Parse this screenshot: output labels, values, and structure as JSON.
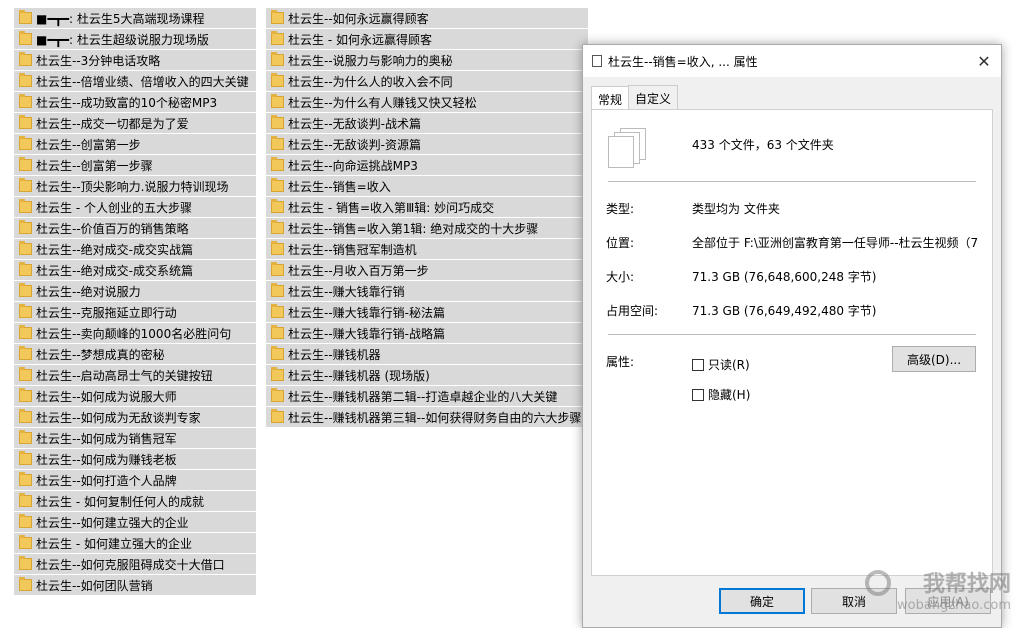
{
  "left_list": [
    "■━┳━: 杜云生5大高端现场课程",
    "■━┳━: 杜云生超级说服力现场版",
    "杜云生--3分钟电话攻略",
    "杜云生--倍增业绩、倍增收入的四大关键",
    "杜云生--成功致富的10个秘密MP3",
    "杜云生--成交一切都是为了爱",
    "杜云生--创富第一步",
    "杜云生--创富第一步骤",
    "杜云生--顶尖影响力.说服力特训现场",
    "杜云生 - 个人创业的五大步骤",
    "杜云生--价值百万的销售策略",
    "杜云生--绝对成交-成交实战篇",
    "杜云生--绝对成交-成交系统篇",
    "杜云生--绝对说服力",
    "杜云生--克服拖延立即行动",
    "杜云生--卖向颠峰的1000名必胜问句",
    "杜云生--梦想成真的密秘",
    "杜云生--启动高昂士气的关键按钮",
    "杜云生--如何成为说服大师",
    "杜云生--如何成为无敌谈判专家",
    "杜云生--如何成为销售冠军",
    "杜云生--如何成为赚钱老板",
    "杜云生--如何打造个人品牌",
    "杜云生 - 如何复制任何人的成就",
    "杜云生--如何建立强大的企业",
    "杜云生 - 如何建立强大的企业",
    "杜云生--如何克服阻碍成交十大借口",
    "杜云生--如何团队营销"
  ],
  "right_list": [
    "杜云生--如何永远赢得顾客",
    "杜云生 - 如何永远赢得顾客",
    "杜云生--说服力与影响力的奥秘",
    "杜云生--为什么人的收入会不同",
    "杜云生--为什么有人赚钱又快又轻松",
    "杜云生--无敌谈判-战术篇",
    "杜云生--无敌谈判-资源篇",
    "杜云生--向命运挑战MP3",
    "杜云生--销售=收入",
    "杜云生 - 销售=收入第Ⅲ辑: 妙问巧成交",
    "杜云生--销售=收入第1辑: 绝对成交的十大步骤",
    "杜云生--销售冠军制造机",
    "杜云生--月收入百万第一步",
    "杜云生--赚大钱靠行销",
    "杜云生--赚大钱靠行销-秘法篇",
    "杜云生--赚大钱靠行销-战略篇",
    "杜云生--赚钱机器",
    "杜云生--赚钱机器 (现场版)",
    "杜云生--赚钱机器第二辑--打造卓越企业的八大关键",
    "杜云生--赚钱机器第三辑--如何获得财务自由的六大步骤"
  ],
  "dialog": {
    "title": "杜云生--销售=收入, ... 属性",
    "close": "✕",
    "tabs": [
      "常规",
      "自定义"
    ],
    "summary": "433 个文件，63 个文件夹",
    "type_label": "类型:",
    "type_value": "类型均为 文件夹",
    "location_label": "位置:",
    "location_value": "全部位于 F:\\亚洲创富教育第一任导师--杜云生视频（7",
    "size_label": "大小:",
    "size_value": "71.3 GB (76,648,600,248 字节)",
    "disk_label": "占用空间:",
    "disk_value": "71.3 GB (76,649,492,480 字节)",
    "attr_label": "属性:",
    "readonly": "只读(R)",
    "hidden": "隐藏(H)",
    "advanced": "高级(D)...",
    "ok": "确定",
    "cancel": "取消",
    "apply": "应用(A)"
  },
  "watermark": {
    "cn": "我帮找网",
    "en": "wobangzhao.com"
  }
}
